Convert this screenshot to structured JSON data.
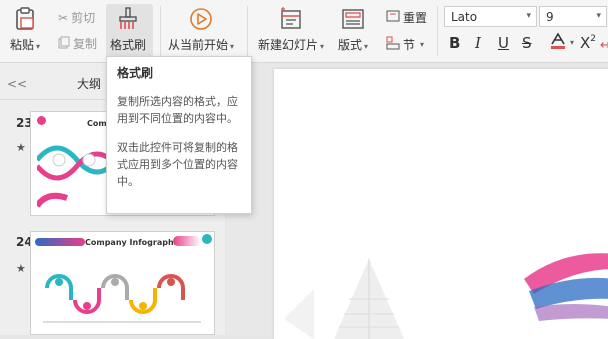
{
  "ribbon": {
    "paste_label": "粘贴",
    "cut_label": "剪切",
    "copy_label": "复制",
    "format_painter_label": "格式刷",
    "from_current_label": "从当前开始",
    "new_slide_label": "新建幻灯片",
    "layout_label": "版式",
    "section_label": "节",
    "reset_label": "重置",
    "font_name": "Lato",
    "font_size": "9"
  },
  "panel": {
    "outline_tab": "大纲",
    "collapse_symbol": "<<",
    "slides": [
      {
        "number": "23",
        "title": "Compa"
      },
      {
        "number": "24",
        "title": "Company Infographic"
      }
    ]
  },
  "tooltip": {
    "title": "格式刷",
    "line1": "复制所选内容的格式，应用到不同位置的内容中。",
    "line2": "双击此控件可将复制的格式应用到多个位置的内容中。"
  },
  "colors": {
    "accent_red": "#d9534f",
    "teal": "#2bb6c4",
    "pink": "#e83e8c",
    "orange": "#f08a24",
    "yellow": "#f4b400"
  }
}
